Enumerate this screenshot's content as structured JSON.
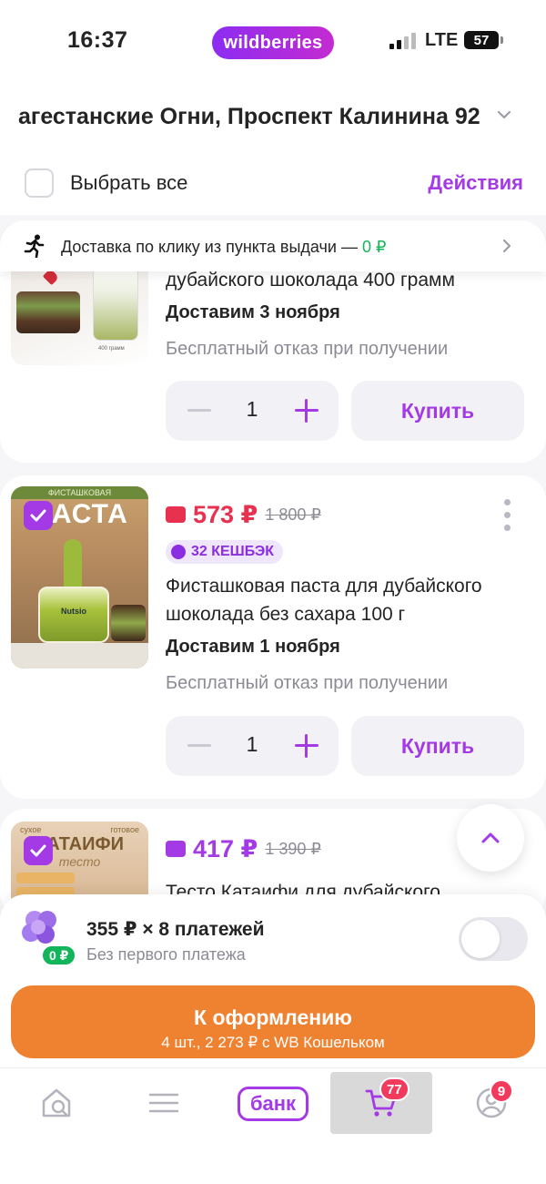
{
  "status_bar": {
    "time": "16:37",
    "brand": "wildberries",
    "network": "LTE",
    "battery": "57"
  },
  "address": {
    "text": "агестанские Огни, Проспект Калинина 92"
  },
  "select_all": {
    "label": "Выбрать все",
    "actions_label": "Действия"
  },
  "delivery_banner": {
    "text": "Доставка по клику из пункта выдачи — ",
    "price": "0 ₽"
  },
  "items": [
    {
      "title": "дубайского шоколада 400 грамм",
      "delivery": "Доставим 3 ноября",
      "refusal": "Бесплатный отказ при получении",
      "quantity": "1",
      "buy_label": "Купить",
      "image_caption": "400 грамм"
    },
    {
      "price": "573 ₽",
      "old_price": "1 800 ₽",
      "cashback": "32 КЕШБЭК",
      "title_line1": "Фисташковая паста для дубайского",
      "title_line2": "шоколада без сахара 100 г",
      "delivery": "Доставим 1 ноября",
      "refusal": "Бесплатный отказ при получении",
      "quantity": "1",
      "buy_label": "Купить",
      "image_top": "ФИСТАШКОВАЯ",
      "image_title": "ПАСТА",
      "image_brand": "Nutsio"
    },
    {
      "price": "417 ₽",
      "old_price": "1 390 ₽",
      "title": "Тесто Катаифи для дубайского",
      "image_top_left": "сухое",
      "image_top_right": "готовое",
      "image_title": "КАТАИФИ",
      "image_sub": "тесто"
    }
  ],
  "installment": {
    "title": "355 ₽ × 8 платежей",
    "subtitle": "Без первого платежа",
    "badge": "0 ₽",
    "enabled": false
  },
  "checkout": {
    "label": "К оформлению",
    "summary": "4 шт., 2 273 ₽ с WB Кошельком"
  },
  "tabbar": {
    "items": [
      {
        "name": "home-search-icon"
      },
      {
        "name": "catalog-icon"
      },
      {
        "name": "bank",
        "label": "банк"
      },
      {
        "name": "cart-icon",
        "badge": "77",
        "active": true
      },
      {
        "name": "profile-icon",
        "badge": "9"
      }
    ]
  },
  "colors": {
    "accent": "#a33ae6",
    "price_red": "#e8304f",
    "checkout": "#ef8230",
    "green": "#13b55b",
    "badge": "#f23a5c"
  }
}
